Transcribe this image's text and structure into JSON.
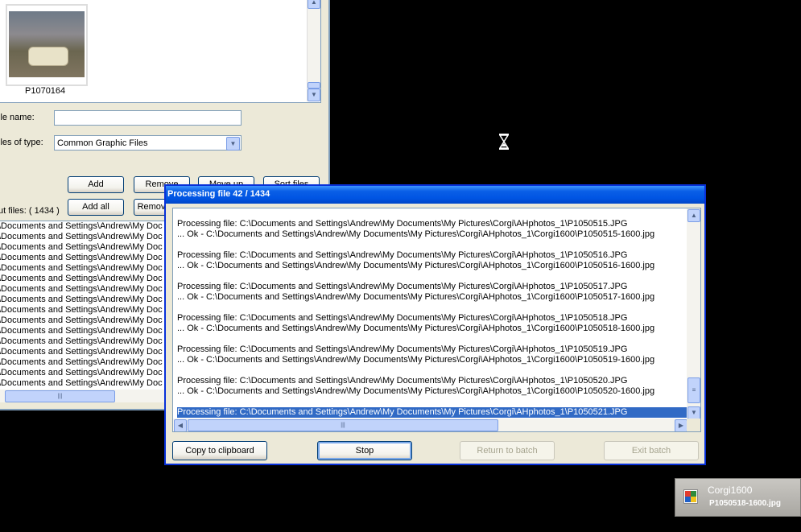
{
  "background_window": {
    "thumbnail_label": "P1070164",
    "file_name_label": "ile name:",
    "file_name_value": "",
    "files_of_type_label": "iles of type:",
    "files_of_type_value": "Common Graphic Files",
    "buttons": {
      "add": "Add",
      "remove": "Remove",
      "move_up": "Move up",
      "sort_files": "Sort files",
      "add_all": "Add all",
      "remove_all": "Remov"
    },
    "input_files_label": "ut files: ( 1434 )",
    "file_rows": [
      "\\Documents and Settings\\Andrew\\My Doc",
      "\\Documents and Settings\\Andrew\\My Doc",
      "\\Documents and Settings\\Andrew\\My Doc",
      "\\Documents and Settings\\Andrew\\My Doc",
      "\\Documents and Settings\\Andrew\\My Doc",
      "\\Documents and Settings\\Andrew\\My Doc",
      "\\Documents and Settings\\Andrew\\My Doc",
      "\\Documents and Settings\\Andrew\\My Doc",
      "\\Documents and Settings\\Andrew\\My Doc",
      "\\Documents and Settings\\Andrew\\My Doc",
      "\\Documents and Settings\\Andrew\\My Doc",
      "\\Documents and Settings\\Andrew\\My Doc",
      "\\Documents and Settings\\Andrew\\My Doc",
      "\\Documents and Settings\\Andrew\\My Doc",
      "\\Documents and Settings\\Andrew\\My Doc",
      "\\Documents and Settings\\Andrew\\My Doc"
    ]
  },
  "dialog": {
    "title": "Processing file 42 / 1434",
    "log": [
      {
        "processing": "Processing file: C:\\Documents and Settings\\Andrew\\My Documents\\My Pictures\\Corgi\\AHphotos_1\\P1050515.JPG",
        "ok": "... Ok - C:\\Documents and Settings\\Andrew\\My Documents\\My Pictures\\Corgi\\AHphotos_1\\Corgi1600\\P1050515-1600.jpg"
      },
      {
        "processing": "Processing file: C:\\Documents and Settings\\Andrew\\My Documents\\My Pictures\\Corgi\\AHphotos_1\\P1050516.JPG",
        "ok": "... Ok - C:\\Documents and Settings\\Andrew\\My Documents\\My Pictures\\Corgi\\AHphotos_1\\Corgi1600\\P1050516-1600.jpg"
      },
      {
        "processing": "Processing file: C:\\Documents and Settings\\Andrew\\My Documents\\My Pictures\\Corgi\\AHphotos_1\\P1050517.JPG",
        "ok": "... Ok - C:\\Documents and Settings\\Andrew\\My Documents\\My Pictures\\Corgi\\AHphotos_1\\Corgi1600\\P1050517-1600.jpg"
      },
      {
        "processing": "Processing file: C:\\Documents and Settings\\Andrew\\My Documents\\My Pictures\\Corgi\\AHphotos_1\\P1050518.JPG",
        "ok": "... Ok - C:\\Documents and Settings\\Andrew\\My Documents\\My Pictures\\Corgi\\AHphotos_1\\Corgi1600\\P1050518-1600.jpg"
      },
      {
        "processing": "Processing file: C:\\Documents and Settings\\Andrew\\My Documents\\My Pictures\\Corgi\\AHphotos_1\\P1050519.JPG",
        "ok": "... Ok - C:\\Documents and Settings\\Andrew\\My Documents\\My Pictures\\Corgi\\AHphotos_1\\Corgi1600\\P1050519-1600.jpg"
      },
      {
        "processing": "Processing file: C:\\Documents and Settings\\Andrew\\My Documents\\My Pictures\\Corgi\\AHphotos_1\\P1050520.JPG",
        "ok": "... Ok - C:\\Documents and Settings\\Andrew\\My Documents\\My Pictures\\Corgi\\AHphotos_1\\Corgi1600\\P1050520-1600.jpg"
      }
    ],
    "current": "Processing file: C:\\Documents and Settings\\Andrew\\My Documents\\My Pictures\\Corgi\\AHphotos_1\\P1050521.JPG",
    "buttons": {
      "copy": "Copy to clipboard",
      "stop": "Stop",
      "return": "Return to batch",
      "exit": "Exit batch"
    }
  },
  "tray": {
    "title": "Corgi1600",
    "subtitle": "P1050518-1600.jpg"
  },
  "colors": {
    "title_bar": "#0054e3",
    "selection": "#316ac5",
    "desktop": "#000000"
  }
}
